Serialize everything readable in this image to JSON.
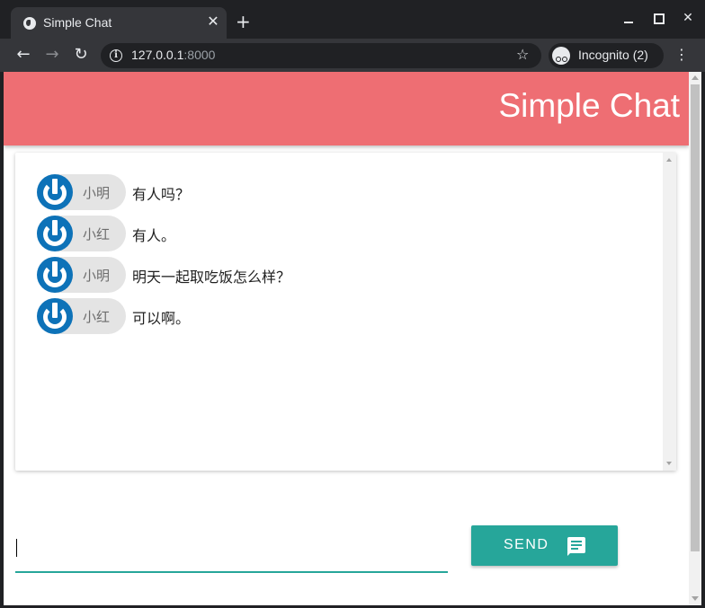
{
  "browser": {
    "tab_title": "Simple Chat",
    "tab_close": "✕",
    "new_tab": "+",
    "url_host": "127.0.0.1",
    "url_port": ":8000",
    "incognito_label": "Incognito (2)",
    "icons": {
      "back": "←",
      "forward": "→",
      "reload": "↻",
      "info": "i",
      "star": "☆",
      "menu": "⋮",
      "close": "✕"
    }
  },
  "app": {
    "title": "Simple Chat",
    "header_color": "#ee6e73",
    "accent_color": "#26a69a"
  },
  "messages": [
    {
      "user": "小明",
      "text": "有人吗？"
    },
    {
      "user": "小红",
      "text": "有人。"
    },
    {
      "user": "小明",
      "text": "明天一起取吃饭怎么样？"
    },
    {
      "user": "小红",
      "text": "可以啊。"
    }
  ],
  "composer": {
    "value": "",
    "placeholder": "",
    "send_label": "SEND",
    "send_icon": "message-icon"
  }
}
